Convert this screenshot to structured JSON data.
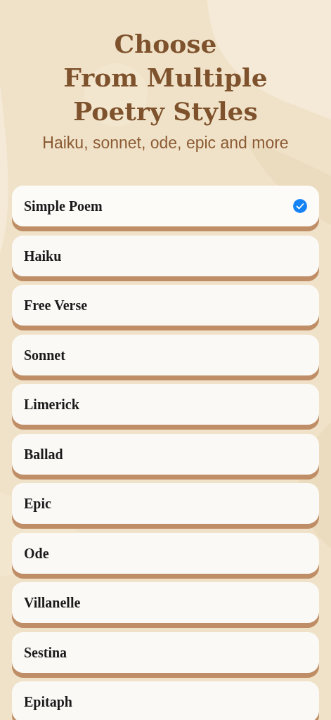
{
  "title_lines": [
    "Choose",
    "From Multiple",
    "Poetry Styles"
  ],
  "subtitle": "Haiku, sonnet, ode, epic and more",
  "styles": [
    {
      "label": "Simple Poem",
      "selected": true
    },
    {
      "label": "Haiku",
      "selected": false
    },
    {
      "label": "Free Verse",
      "selected": false
    },
    {
      "label": "Sonnet",
      "selected": false
    },
    {
      "label": "Limerick",
      "selected": false
    },
    {
      "label": "Ballad",
      "selected": false
    },
    {
      "label": "Epic",
      "selected": false
    },
    {
      "label": "Ode",
      "selected": false
    },
    {
      "label": "Villanelle",
      "selected": false
    },
    {
      "label": "Sestina",
      "selected": false
    },
    {
      "label": "Epitaph",
      "selected": false
    }
  ]
}
